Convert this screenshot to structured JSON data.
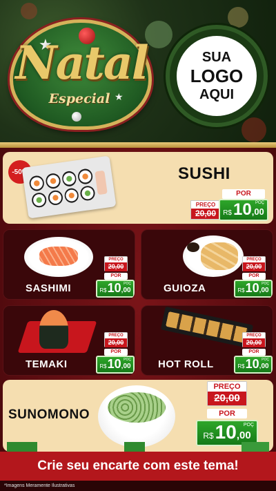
{
  "header": {
    "brand_word": "Natal",
    "brand_sub": "Especial",
    "logo_lines": [
      "SUA",
      "LOGO",
      "AQUI"
    ]
  },
  "items": [
    {
      "name": "SUSHI",
      "discount": "-50%",
      "preco_label": "PREÇO",
      "old_price": "20,00",
      "por_label": "POR",
      "currency": "R$",
      "new_price_int": "10",
      "new_price_dec": ",00",
      "poc": "POÇ"
    },
    {
      "name": "SASHIMI",
      "preco_label": "PREÇO",
      "old_price": "20,00",
      "por_label": "POR",
      "currency": "R$",
      "new_price_int": "10",
      "new_price_dec": ",00",
      "poc": "POÇ"
    },
    {
      "name": "GUIOZA",
      "preco_label": "PREÇO",
      "old_price": "20,00",
      "por_label": "POR",
      "currency": "R$",
      "new_price_int": "10",
      "new_price_dec": ",00",
      "poc": "POÇ"
    },
    {
      "name": "TEMAKI",
      "preco_label": "PREÇO",
      "old_price": "20,00",
      "por_label": "POR",
      "currency": "R$",
      "new_price_int": "10",
      "new_price_dec": ",00",
      "poc": "POÇ"
    },
    {
      "name": "HOT ROLL",
      "preco_label": "PREÇO",
      "old_price": "20,00",
      "por_label": "POR",
      "currency": "R$",
      "new_price_int": "10",
      "new_price_dec": ",00",
      "poc": "POÇ"
    },
    {
      "name": "SUNOMONO",
      "preco_label": "PREÇO",
      "old_price": "20,00",
      "por_label": "POR",
      "currency": "R$",
      "new_price_int": "10",
      "new_price_dec": ",00",
      "poc": "POÇ"
    }
  ],
  "footer": {
    "cta": "Crie seu encarte com este tema!",
    "disclaimer": "*Imagens Meramente Ilustrativas"
  },
  "colors": {
    "accent_red": "#c8161d",
    "price_green": "#1f8f1f",
    "cream": "#f5deb0",
    "gold": "#d6b25a"
  }
}
